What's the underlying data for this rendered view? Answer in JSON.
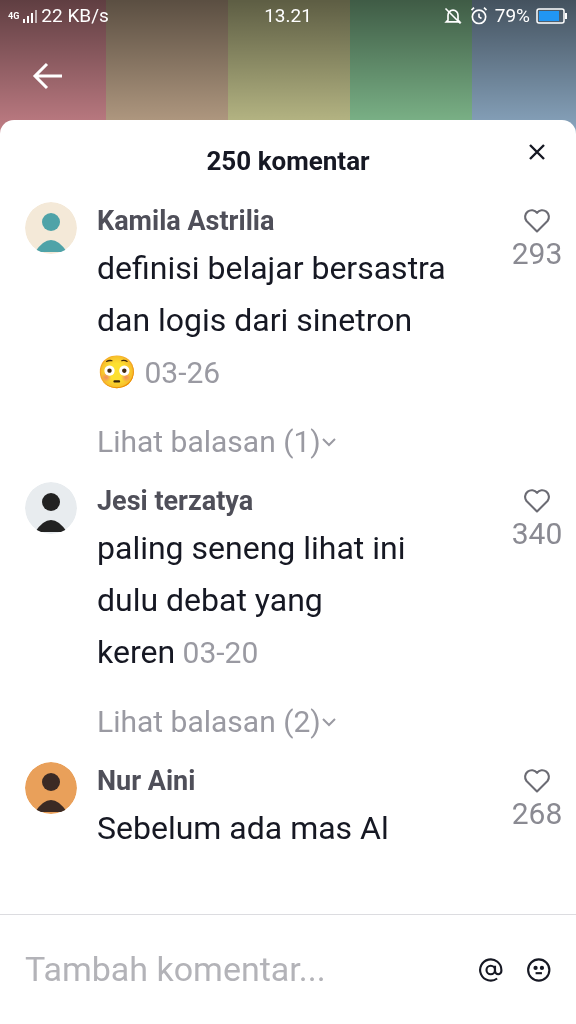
{
  "status_bar": {
    "network": "4G",
    "speed": "22 KB/s",
    "time": "13.21",
    "battery": "79%"
  },
  "sheet": {
    "title": "250 komentar"
  },
  "comments": [
    {
      "name": "Kamila Astrilia",
      "text": "definisi belajar bersastra dan logis dari sinetron😳",
      "date": "03-26",
      "likes": "293",
      "liked": false,
      "replies": "Lihat balasan (1)"
    },
    {
      "name": "Jesi terzatya",
      "text": "paling seneng lihat ini dulu debat yang keren",
      "date": "03-20",
      "likes": "340",
      "liked": false,
      "replies": "Lihat balasan (2)"
    },
    {
      "name": "Nur Aini",
      "text": "Sebelum ada mas Al",
      "likes": "268",
      "liked": false
    }
  ],
  "composer": {
    "placeholder": "Tambah komentar..."
  }
}
